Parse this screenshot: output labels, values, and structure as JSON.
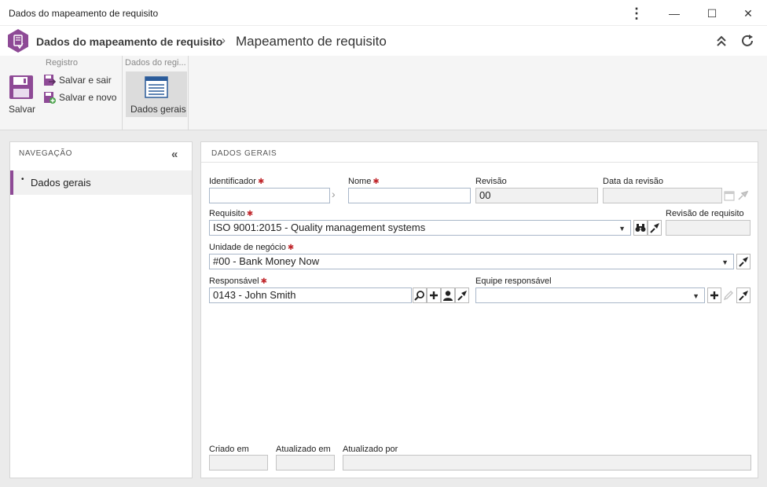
{
  "window": {
    "title": "Dados do mapeamento de requisito",
    "kebab": "⋮",
    "minimize": "—",
    "maximize": "☐",
    "close": "✕"
  },
  "header": {
    "breadcrumb_parent": "Dados do mapeamento de requisito",
    "breadcrumb_sep": "›",
    "breadcrumb_current": "Mapeamento de requisito"
  },
  "ribbon": {
    "group_registro": "Registro",
    "group_dados": "Dados do regi...",
    "save": "Salvar",
    "save_exit": "Salvar e sair",
    "save_new": "Salvar e novo",
    "general_data": "Dados gerais"
  },
  "nav": {
    "title": "NAVEGAÇÃO",
    "items": [
      {
        "label": "Dados gerais"
      }
    ]
  },
  "form": {
    "title": "DADOS GERAIS",
    "identificador_label": "Identificador",
    "identificador_value": "",
    "nome_label": "Nome",
    "nome_value": "",
    "revisao_label": "Revisão",
    "revisao_value": "00",
    "data_revisao_label": "Data da revisão",
    "data_revisao_value": "",
    "requisito_label": "Requisito",
    "requisito_value": "ISO 9001:2015 - Quality management systems",
    "revisao_requisito_label": "Revisão de requisito",
    "revisao_requisito_value": "",
    "unidade_label": "Unidade de negócio",
    "unidade_value": "#00 - Bank Money Now",
    "responsavel_label": "Responsável",
    "responsavel_value": "0143 - John Smith",
    "equipe_label": "Equipe responsável",
    "equipe_value": "",
    "criado_label": "Criado em",
    "criado_value": "",
    "atualizado_em_label": "Atualizado em",
    "atualizado_em_value": "",
    "atualizado_por_label": "Atualizado por",
    "atualizado_por_value": ""
  },
  "colors": {
    "accent": "#8e4a96",
    "required": "#c0282d",
    "field_border": "#a9b7c9"
  }
}
